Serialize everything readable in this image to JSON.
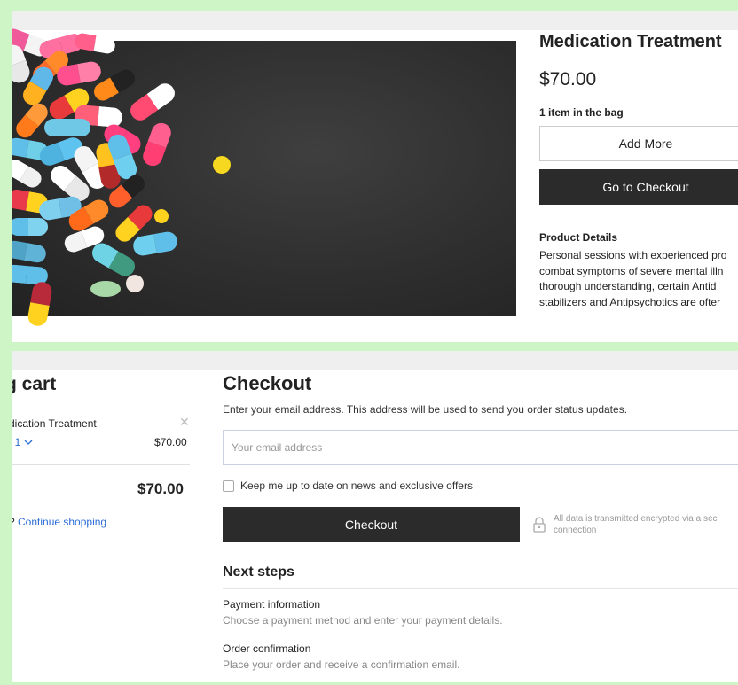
{
  "product": {
    "title": "Medication Treatment",
    "price": "$70.00",
    "bag_count": "1 item in the bag",
    "add_more_label": "Add More",
    "go_checkout_label": "Go to Checkout",
    "details_heading": "Product Details",
    "details_lines": [
      "Personal sessions with experienced pro",
      "combat symptoms of severe mental illn",
      "thorough understanding, certain Antid",
      "stabilizers and Antipsychotics are ofter"
    ]
  },
  "cart": {
    "title": "g cart",
    "item_name": "dication Treatment",
    "item_qty": ": 1",
    "item_price": "$70.00",
    "total": "$70.00",
    "continue_prefix": "? ",
    "continue_link": "Continue shopping"
  },
  "checkout": {
    "title": "Checkout",
    "description": "Enter your email address. This address will be used to send you order status updates.",
    "email_placeholder": "Your email address",
    "newsletter_label": "Keep me up to date on news and exclusive offers",
    "checkout_button": "Checkout",
    "secure_line1": "All data is transmitted encrypted via a sec",
    "secure_line2": "connection",
    "next_steps_title": "Next steps",
    "steps": [
      {
        "title": "Payment information",
        "desc": "Choose a payment method and enter your payment details."
      },
      {
        "title": "Order confirmation",
        "desc": "Place your order and receive a confirmation email."
      }
    ]
  },
  "colors": {
    "frame": "#cdf5c6",
    "button_dark": "#2b2b2b",
    "link_blue": "#2a6cd6"
  },
  "icons": [
    "chevron-down-icon",
    "close-icon",
    "lock-icon"
  ]
}
